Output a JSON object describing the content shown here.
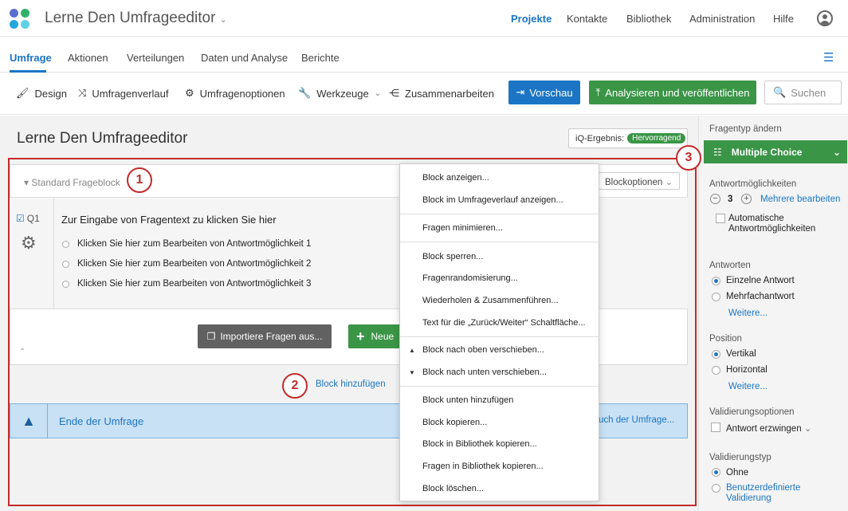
{
  "header": {
    "title": "Lerne Den Umfrageeditor",
    "nav": [
      "Projekte",
      "Kontakte",
      "Bibliothek",
      "Administration",
      "Hilfe"
    ],
    "accent": "#1b75c4"
  },
  "subnav": {
    "tabs": [
      "Umfrage",
      "Aktionen",
      "Verteilungen",
      "Daten und Analyse",
      "Berichte"
    ]
  },
  "toolbar": {
    "tools": [
      "Design",
      "Umfragenverlauf",
      "Umfragenoptionen",
      "Werkzeuge",
      "Zusammenarbeiten"
    ],
    "preview": "Vorschau",
    "publish": "Analysieren und veröffentlichen",
    "search_placeholder": "Suchen"
  },
  "main": {
    "title": "Lerne Den Umfrageeditor",
    "iq_label": "iQ-Ergebnis:",
    "iq_value": "Hervorragend",
    "block_name": "Standard Frageblock",
    "block_options": "Blockoptionen",
    "question": {
      "id": "Q1",
      "text": "Zur Eingabe von Fragentext zu klicken Sie hier",
      "options": [
        "Klicken Sie hier zum Bearbeiten von Antwortmöglichkeit 1",
        "Klicken Sie hier zum Bearbeiten von Antwortmöglichkeit 2",
        "Klicken Sie hier zum Bearbeiten von Antwortmöglichkeit 3"
      ]
    },
    "import_btn": "Importiere Fragen aus...",
    "new_btn": "Neue",
    "add_block": "Block hinzufügen",
    "end_text": "Ende der Umfrage",
    "end_link": "uch der Umfrage...",
    "callouts": [
      "1",
      "2",
      "3"
    ]
  },
  "menu": {
    "items": [
      "Block anzeigen...",
      "Block im Umfrageverlauf anzeigen...",
      "Fragen minimieren...",
      "Block sperren...",
      "Fragenrandomisierung...",
      "Wiederholen & Zusammenführen...",
      "Text für die „Zurück/Weiter“ Schaltfläche...",
      "Block nach oben verschieben...",
      "Block nach unten verschieben...",
      "Block unten hinzufügen",
      "Block kopieren...",
      "Block in Bibliothek kopieren...",
      "Fragen in Bibliothek kopieren...",
      "Block löschen..."
    ]
  },
  "panel": {
    "change_type": "Fragentyp ändern",
    "type": "Multiple Choice",
    "choices_label": "Antwortmöglichkeiten",
    "choices_count": "3",
    "edit_many": "Mehrere bearbeiten",
    "auto_choices": "Automatische Antwortmöglichkeiten",
    "answers_label": "Antworten",
    "single": "Einzelne Antwort",
    "multi": "Mehrfachantwort",
    "more1": "Weitere...",
    "position_label": "Position",
    "vertical": "Vertikal",
    "horizontal": "Horizontal",
    "more2": "Weitere...",
    "validation_options_label": "Validierungsoptionen",
    "force": "Antwort erzwingen",
    "validation_type_label": "Validierungstyp",
    "none": "Ohne",
    "custom": "Benutzerdefinierte Validierung"
  }
}
